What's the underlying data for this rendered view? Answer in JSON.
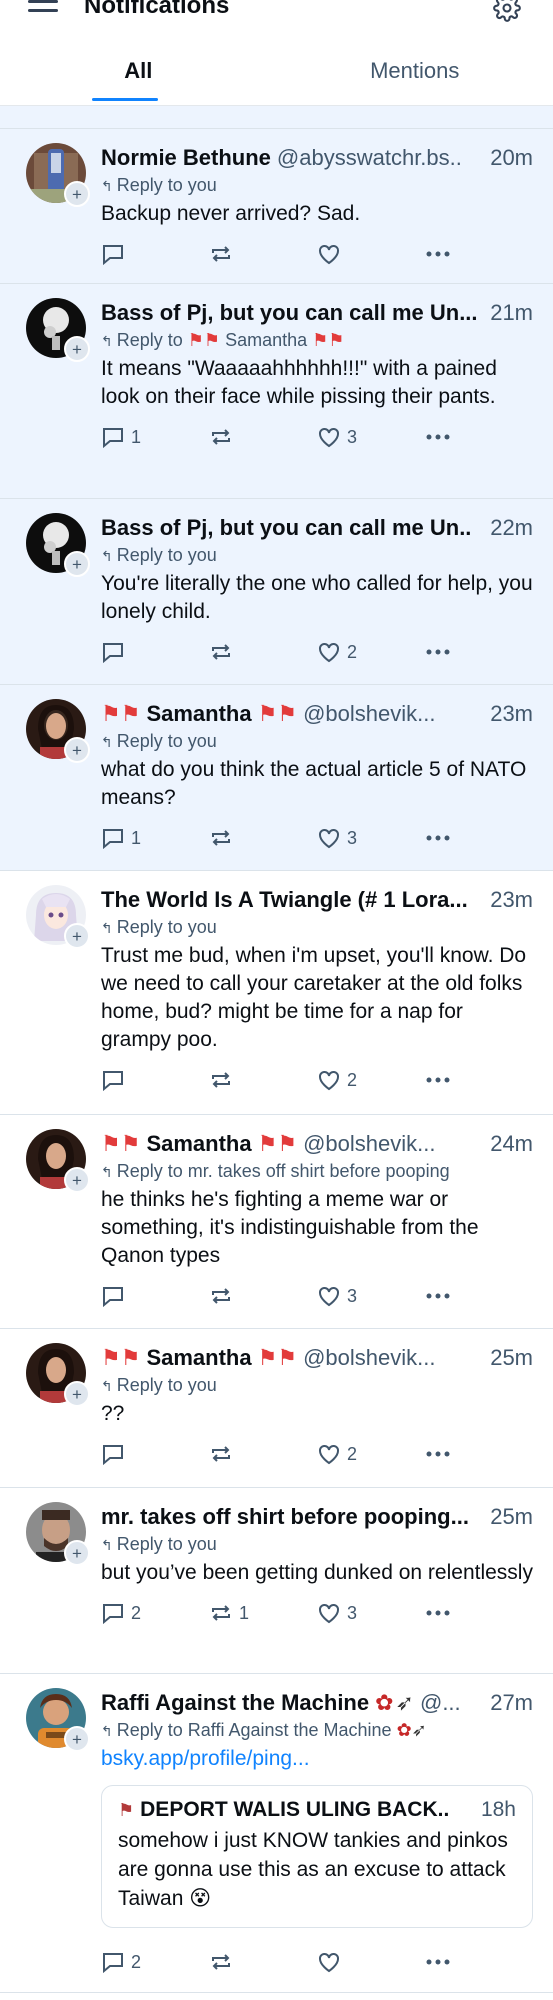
{
  "header": {
    "title": "Notifications",
    "tabs": [
      "All",
      "Mentions"
    ]
  },
  "colors": {
    "accent": "#1083fe",
    "unread_bg": "#edf4fe",
    "muted": "#42576c"
  },
  "notifications": [
    {
      "name": "Normie Bethune",
      "handle": "@abysswatchr.bs..",
      "time": "20m",
      "reply_prefix": "Reply to you",
      "reply_target": "",
      "body": "Backup never arrived? Sad.",
      "replies": "",
      "reposts": "",
      "likes": ""
    },
    {
      "name": "Bass of Pj, but you can call me Un...",
      "handle": "",
      "time": "21m",
      "reply_prefix": "Reply to",
      "reply_target": "Samantha",
      "body": "It means \"Waaaaahhhhhh!!!\" with a pained look on their face while pissing their pants.",
      "replies": "1",
      "reposts": "",
      "likes": "3"
    },
    {
      "name": "Bass of Pj, but you can call me Un..",
      "handle": "",
      "time": "22m",
      "reply_prefix": "Reply to you",
      "reply_target": "",
      "body": "You're literally the one who called for help, you lonely child.",
      "replies": "",
      "reposts": "",
      "likes": "2"
    },
    {
      "name": "Samantha",
      "handle": "@bolshevik...",
      "time": "23m",
      "reply_prefix": "Reply to you",
      "reply_target": "",
      "body": "what do you think the actual article 5 of NATO means?",
      "replies": "1",
      "reposts": "",
      "likes": "3"
    },
    {
      "name": "The World Is A Twiangle (# 1 Lora...",
      "handle": "",
      "time": "23m",
      "reply_prefix": "Reply to you",
      "reply_target": "",
      "body": "Trust me bud, when i'm upset,  you'll know. Do we need to call your caretaker at the old folks home, bud? might be time for a nap for grampy poo.",
      "replies": "",
      "reposts": "",
      "likes": "2"
    },
    {
      "name": "Samantha",
      "handle": "@bolshevik...",
      "time": "24m",
      "reply_prefix": "Reply to mr. takes off shirt before pooping",
      "reply_target": "",
      "body": "he thinks he's fighting a meme war or something, it's indistinguishable from the Qanon types",
      "replies": "",
      "reposts": "",
      "likes": "3"
    },
    {
      "name": "Samantha",
      "handle": "@bolshevik...",
      "time": "25m",
      "reply_prefix": "Reply to you",
      "reply_target": "",
      "body": "??",
      "replies": "",
      "reposts": "",
      "likes": "2"
    },
    {
      "name": "mr. takes off shirt before pooping...",
      "handle": "",
      "time": "25m",
      "reply_prefix": "Reply to you",
      "reply_target": "",
      "body": "but you’ve been getting dunked on relentlessly",
      "replies": "2",
      "reposts": "1",
      "likes": "3"
    },
    {
      "name": "Raffi Against the Machine",
      "handle": "@...",
      "time": "27m",
      "reply_prefix": "Reply to Raffi Against the Machine",
      "reply_target": "",
      "link": "bsky.app/profile/ping...",
      "quote": {
        "name": "DEPORT WALIS ULING BACK..",
        "time": "18h",
        "body": "somehow i just KNOW tankies and pinkos are gonna use this as an excuse to attack Taiwan 😵"
      },
      "replies": "2",
      "reposts": "",
      "likes": ""
    }
  ]
}
